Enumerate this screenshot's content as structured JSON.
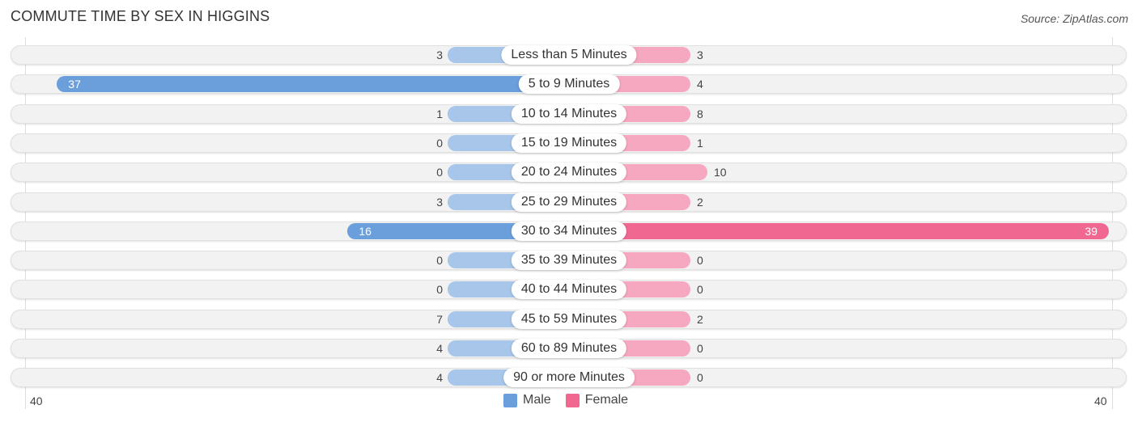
{
  "title": "COMMUTE TIME BY SEX IN HIGGINS",
  "source": "Source: ZipAtlas.com",
  "colors": {
    "male": "#6a9fdb",
    "female": "#f06892",
    "male_light": "#a7c6ea",
    "female_light": "#f6a8c0"
  },
  "chart_data": {
    "type": "bar",
    "orientation": "horizontal-diverging",
    "title": "COMMUTE TIME BY SEX IN HIGGINS",
    "categories": [
      "Less than 5 Minutes",
      "5 to 9 Minutes",
      "10 to 14 Minutes",
      "15 to 19 Minutes",
      "20 to 24 Minutes",
      "25 to 29 Minutes",
      "30 to 34 Minutes",
      "35 to 39 Minutes",
      "40 to 44 Minutes",
      "45 to 59 Minutes",
      "60 to 89 Minutes",
      "90 or more Minutes"
    ],
    "series": [
      {
        "name": "Male",
        "values": [
          3,
          37,
          1,
          0,
          0,
          3,
          16,
          0,
          0,
          7,
          4,
          4
        ]
      },
      {
        "name": "Female",
        "values": [
          3,
          4,
          8,
          1,
          10,
          2,
          39,
          0,
          0,
          2,
          0,
          0
        ]
      }
    ],
    "axis": {
      "left_tick": "40",
      "right_tick": "40",
      "range": [
        40,
        40
      ]
    },
    "legend": {
      "position": "bottom-center",
      "items": [
        "Male",
        "Female"
      ]
    }
  }
}
